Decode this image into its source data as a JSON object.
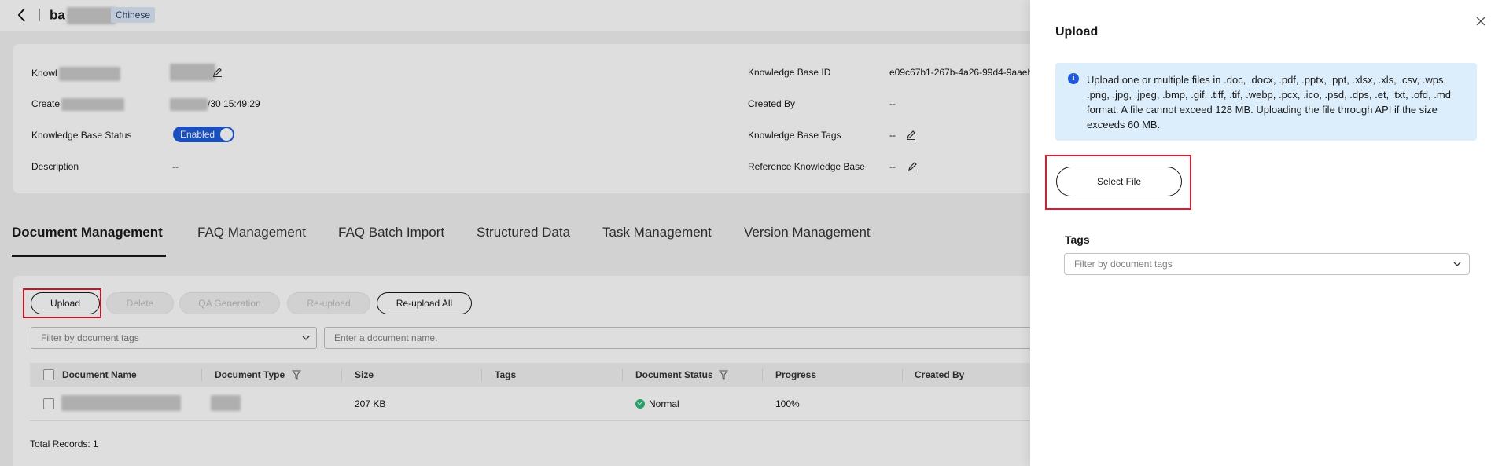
{
  "header": {
    "kb_name_visible": "ba",
    "language_tag": "Chinese"
  },
  "info": {
    "kb_name_label": "Knowl",
    "created_label": "Create",
    "created_time_suffix": "/30 15:49:29",
    "status_label": "Knowledge Base Status",
    "status_value": "Enabled",
    "description_label": "Description",
    "description_value": "--",
    "id_label": "Knowledge Base ID",
    "id_value": "e09c67b1-267b-4a26-99d4-9aaeb",
    "created_by_label": "Created By",
    "created_by_value": "--",
    "tags_label": "Knowledge Base Tags",
    "tags_value": "--",
    "reference_label": "Reference Knowledge Base",
    "reference_value": "--"
  },
  "tabs": [
    {
      "label": "Document Management",
      "active": true
    },
    {
      "label": "FAQ Management",
      "active": false
    },
    {
      "label": "FAQ Batch Import",
      "active": false
    },
    {
      "label": "Structured Data",
      "active": false
    },
    {
      "label": "Task Management",
      "active": false
    },
    {
      "label": "Version Management",
      "active": false
    }
  ],
  "toolbar": {
    "upload": "Upload",
    "delete": "Delete",
    "qa_generation": "QA Generation",
    "reupload": "Re-upload",
    "reupload_all": "Re-upload All"
  },
  "filters": {
    "tag_placeholder": "Filter by document tags",
    "name_placeholder": "Enter a document name."
  },
  "table": {
    "columns": [
      "Document Name",
      "Document Type",
      "Size",
      "Tags",
      "Document Status",
      "Progress",
      "Created By"
    ],
    "rows": [
      {
        "name": "",
        "type": "",
        "size": "207 KB",
        "tags": "",
        "status": "Normal",
        "progress": "100%",
        "created_by": ""
      }
    ],
    "total": "Total Records: 1"
  },
  "drawer": {
    "title": "Upload",
    "notice": "Upload one or multiple files in .doc, .docx, .pdf, .pptx, .ppt, .xlsx, .xls, .csv, .wps, .png, .jpg, .jpeg, .bmp, .gif, .tiff, .tif, .webp, .pcx, .ico, .psd, .dps, .et, .txt, .ofd, .md format. A file cannot exceed 128 MB. Uploading the file through API if the size exceeds 60 MB.",
    "select_file": "Select File",
    "tags_label": "Tags",
    "tags_placeholder": "Filter by document tags"
  },
  "colors": {
    "accent": "#1f5bd9",
    "highlight": "#e1192f",
    "notice_bg": "#dceefc",
    "success": "#2fb87a"
  }
}
